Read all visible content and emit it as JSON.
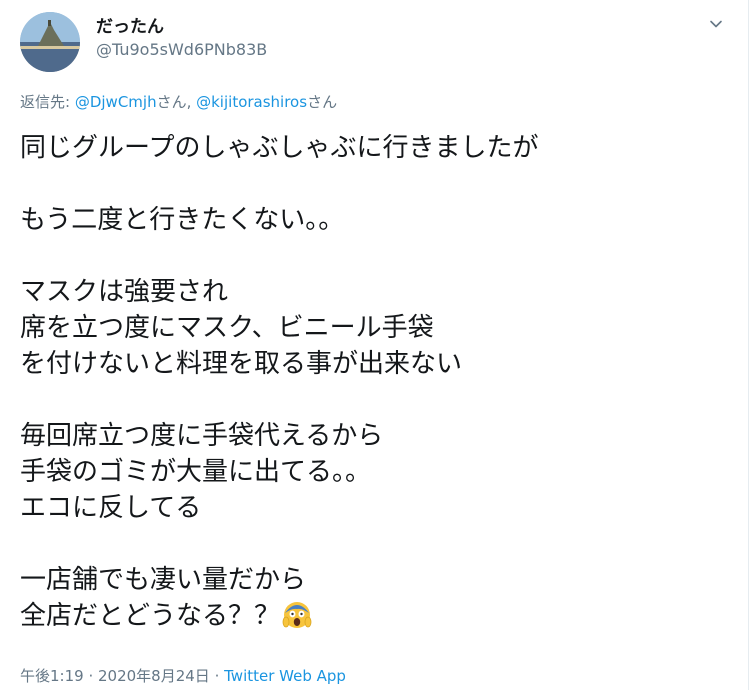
{
  "user": {
    "display_name": "だったん",
    "handle": "@Tu9o5sWd6PNb83B"
  },
  "reply": {
    "prefix": "返信先: ",
    "mention1": "@DjwCmjh",
    "suffix1": "さん, ",
    "mention2": "@kijitorashiros",
    "suffix2": "さん"
  },
  "tweet": {
    "lines": [
      "同じグループのしゃぶしゃぶに行きましたが",
      "",
      "もう二度と行きたくない。。",
      "",
      "マスクは強要され",
      "席を立つ度にマスク、ビニール手袋",
      "を付けないと料理を取る事が出来ない",
      "",
      "毎回席立つ度に手袋代えるから",
      "手袋のゴミが大量に出てる。。",
      "エコに反してる",
      "",
      "一店舗でも凄い量だから",
      "全店だとどうなる？？"
    ],
    "emoji": "screaming-face-emoji"
  },
  "meta": {
    "time": "午後1:19",
    "sep1": " · ",
    "date": "2020年8月24日",
    "sep2": " · ",
    "app": "Twitter Web App"
  },
  "colors": {
    "link": "#1b95e0",
    "secondary": "#657786",
    "text": "#14171a"
  }
}
